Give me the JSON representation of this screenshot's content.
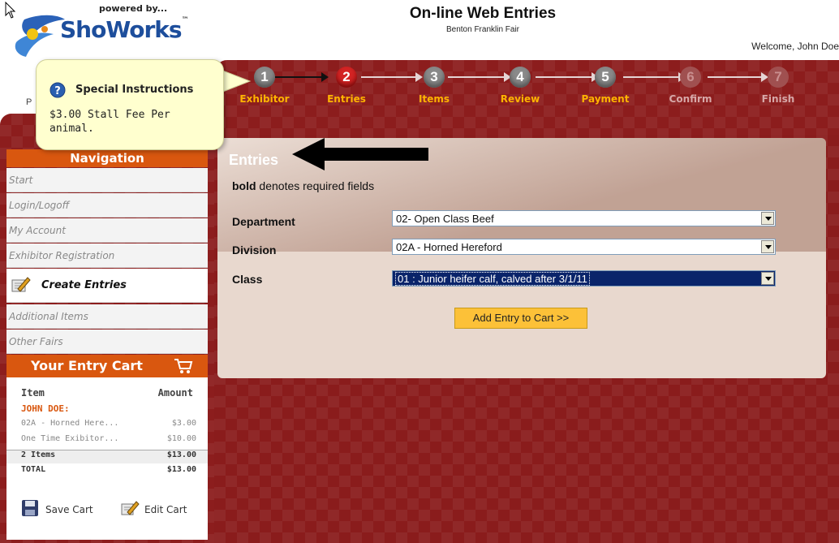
{
  "header": {
    "powered_by": "powered by...",
    "brand": "ShoWorks",
    "brand_tm": "™",
    "title": "On-line Web Entries",
    "subtitle": "Benton Franklin Fair",
    "welcome": "Welcome, John Doe"
  },
  "steps": [
    {
      "num": "1",
      "label": "Exhibitor",
      "state": "done"
    },
    {
      "num": "2",
      "label": "Entries",
      "state": "current"
    },
    {
      "num": "3",
      "label": "Items",
      "state": "done"
    },
    {
      "num": "4",
      "label": "Review",
      "state": "done"
    },
    {
      "num": "5",
      "label": "Payment",
      "state": "done"
    },
    {
      "num": "6",
      "label": "Confirm",
      "state": "todo"
    },
    {
      "num": "7",
      "label": "Finish",
      "state": "todo"
    }
  ],
  "tooltip": {
    "title": "Special Instructions",
    "body": "$3.00 Stall Fee Per animal.",
    "peek": "P"
  },
  "navigation": {
    "heading": "Navigation",
    "items": [
      "Start",
      "Login/Logoff",
      "My Account",
      "Exhibitor Registration",
      "Create Entries",
      "Additional Items",
      "Other Fairs"
    ]
  },
  "cart": {
    "heading": "Your Entry Cart",
    "col_item": "Item",
    "col_amount": "Amount",
    "owner": "JOHN DOE:",
    "lines": [
      {
        "item": "02A - Horned Here...",
        "amount": "$3.00"
      },
      {
        "item": "One Time Exibitor...",
        "amount": "$10.00"
      }
    ],
    "subtotal_label": "2 Items",
    "subtotal_amount": "$13.00",
    "total_label": "TOTAL",
    "total_amount": "$13.00",
    "save_label": "Save Cart",
    "edit_label": "Edit Cart"
  },
  "entries": {
    "title": "Entries",
    "note_bold": "bold",
    "note_rest": " denotes required fields",
    "department_label": "Department",
    "department_value": "02- Open Class Beef",
    "division_label": "Division",
    "division_value": "02A - Horned Hereford",
    "class_label": "Class",
    "class_value": "01 : Junior heifer calf, calved after 3/1/11",
    "add_button": "Add Entry to Cart >>"
  },
  "colors": {
    "maroon": "#8c1d1d",
    "orange": "#d9570f",
    "gold": "#ffb400",
    "current_step": "#d42424"
  }
}
